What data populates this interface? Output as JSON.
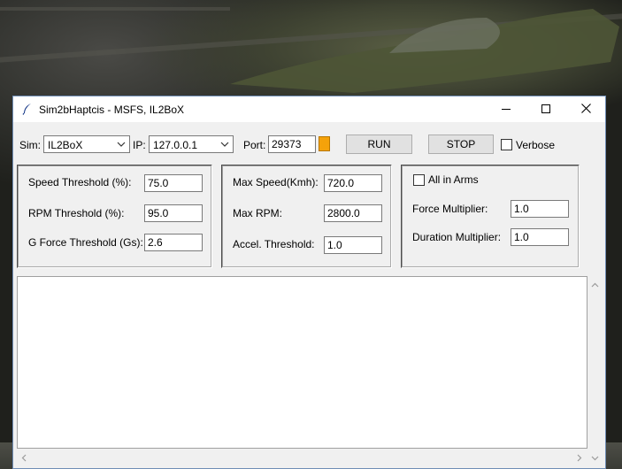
{
  "window": {
    "title": "Sim2bHaptcis - MSFS, IL2BoX"
  },
  "toolbar": {
    "sim_label": "Sim:",
    "sim_value": "IL2BoX",
    "ip_label": "IP:",
    "ip_value": "127.0.0.1",
    "port_label": "Port:",
    "port_value": "29373",
    "status_color": "#f5a20a",
    "run_label": "RUN",
    "stop_label": "STOP",
    "verbose_label": "Verbose",
    "verbose_checked": false
  },
  "thresholds": {
    "speed_label": "Speed Threshold (%):",
    "speed_value": "75.0",
    "rpm_label": "RPM Threshold (%):",
    "rpm_value": "95.0",
    "g_label": "G Force Threshold (Gs):",
    "g_value": "2.6"
  },
  "limits": {
    "max_speed_label": "Max Speed(Kmh):",
    "max_speed_value": "720.0",
    "max_rpm_label": "Max RPM:",
    "max_rpm_value": "2800.0",
    "accel_label": "Accel. Threshold:",
    "accel_value": "1.0"
  },
  "multipliers": {
    "all_in_arms_label": "All in Arms",
    "all_in_arms_checked": false,
    "force_label": "Force Multiplier:",
    "force_value": "1.0",
    "duration_label": "Duration Multiplier:",
    "duration_value": "1.0"
  },
  "icons": {
    "app": "feather-icon",
    "minimize": "minimize-icon",
    "maximize": "maximize-icon",
    "close": "close-icon"
  }
}
